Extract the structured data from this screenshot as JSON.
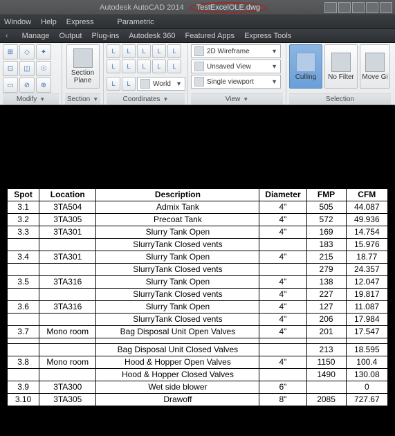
{
  "title": {
    "app": "Autodesk AutoCAD 2014",
    "file": "TestExcelOLE.dwg"
  },
  "menu": [
    "Window",
    "Help",
    "Express"
  ],
  "tabs": [
    "Manage",
    "Output",
    "Plug-ins",
    "Autodesk 360",
    "Featured Apps",
    "Express Tools"
  ],
  "ribbon": {
    "modify_label": "Modify",
    "section_label": "Section",
    "section_plane": "Section\nPlane",
    "coordinates_label": "Coordinates",
    "world": "World",
    "view_label": "View",
    "wireframe": "2D Wireframe",
    "unsaved": "Unsaved View",
    "viewport": "Single viewport",
    "selection_label": "Selection",
    "culling": "Culling",
    "nofilter": "No Filter",
    "movegi": "Move Gi"
  },
  "menu_parametric": "Parametric",
  "table": {
    "headers": [
      "Spot",
      "Location",
      "Description",
      "Diameter",
      "FMP",
      "CFM"
    ],
    "rows": [
      {
        "spot": "3.1",
        "location": "3TA504",
        "desc": "Admix Tank",
        "dia": "4\"",
        "fmp": "505",
        "cfm": "44.087"
      },
      {
        "spot": "3.2",
        "location": "3TA305",
        "desc": "Precoat Tank",
        "dia": "4\"",
        "fmp": "572",
        "cfm": "49.936"
      },
      {
        "spot": "3.3",
        "location": "3TA301",
        "desc": "Slurry Tank Open",
        "dia": "4\"",
        "fmp": "169",
        "cfm": "14.754"
      },
      {
        "spot": "",
        "location": "",
        "desc": "SlurryTank Closed vents",
        "dia": "",
        "fmp": "183",
        "cfm": "15.976"
      },
      {
        "spot": "3.4",
        "location": "3TA301",
        "desc": "Slurry Tank Open",
        "dia": "4\"",
        "fmp": "215",
        "cfm": "18.77"
      },
      {
        "spot": "",
        "location": "",
        "desc": "SlurryTank Closed vents",
        "dia": "",
        "fmp": "279",
        "cfm": "24.357"
      },
      {
        "spot": "3.5",
        "location": "3TA316",
        "desc": "Slurry Tank Open",
        "dia": "4\"",
        "fmp": "138",
        "cfm": "12.047"
      },
      {
        "spot": "",
        "location": "",
        "desc": "SlurryTank Closed vents",
        "dia": "4\"",
        "fmp": "227",
        "cfm": "19.817"
      },
      {
        "spot": "3.6",
        "location": "3TA316",
        "desc": "Slurry Tank Open",
        "dia": "4\"",
        "fmp": "127",
        "cfm": "11.087"
      },
      {
        "spot": "",
        "location": "",
        "desc": "SlurryTank Closed vents",
        "dia": "4\"",
        "fmp": "206",
        "cfm": "17.984"
      },
      {
        "spot": "3.7",
        "location": "Mono room",
        "desc": "Bag Disposal Unit Open Valves",
        "dia": "4\"",
        "fmp": "201",
        "cfm": "17.547"
      },
      {
        "spacer": true
      },
      {
        "spot": "",
        "location": "",
        "desc": "Bag Disposal Unit Closed Valves",
        "dia": "",
        "fmp": "213",
        "cfm": "18.595"
      },
      {
        "spot": "3.8",
        "location": "Mono room",
        "desc": "Hood & Hopper Open Valves",
        "dia": "4\"",
        "fmp": "1150",
        "cfm": "100.4"
      },
      {
        "spot": "",
        "location": "",
        "desc": "Hood & Hopper Closed Valves",
        "dia": "",
        "fmp": "1490",
        "cfm": "130.08"
      },
      {
        "spot": "3.9",
        "location": "3TA300",
        "desc": "Wet side blower",
        "dia": "6\"",
        "fmp": "",
        "cfm": "0"
      },
      {
        "spot": "3.10",
        "location": "3TA305",
        "desc": "Drawoff",
        "dia": "8\"",
        "fmp": "2085",
        "cfm": "727.67"
      }
    ]
  }
}
